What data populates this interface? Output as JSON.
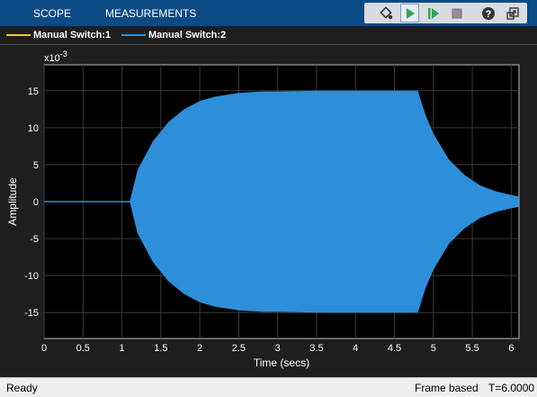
{
  "toolstrip": {
    "tabs": [
      "SCOPE",
      "MEASUREMENTS"
    ],
    "buttons": [
      "highlight-simulink-block-icon",
      "run-icon",
      "step-forward-icon",
      "stop-icon",
      "help-icon",
      "undock-icon"
    ]
  },
  "legend": {
    "items": [
      {
        "label": "Manual Switch:1",
        "color": "#f2c230"
      },
      {
        "label": "Manual Switch:2",
        "color": "#2d8fd9"
      }
    ]
  },
  "status": {
    "left": "Ready",
    "mode": "Frame based",
    "time": "T=6.0000"
  },
  "chart_data": {
    "type": "line",
    "xlabel": "Time (secs)",
    "ylabel": "Amplitude",
    "y_exponent_label": "x10",
    "y_exponent_power": "-3",
    "xlim": [
      0,
      6.1
    ],
    "ylim": [
      -0.0185,
      0.0185
    ],
    "x_ticks": [
      0,
      0.5,
      1,
      1.5,
      2,
      2.5,
      3,
      3.5,
      4,
      4.5,
      5,
      5.5,
      6
    ],
    "x_tick_labels": [
      "0",
      "0.5",
      "1",
      "1.5",
      "2",
      "2.5",
      "3",
      "3.5",
      "4",
      "4.5",
      "5",
      "5.5",
      "6"
    ],
    "y_ticks": [
      -0.015,
      -0.01,
      -0.005,
      0,
      0.005,
      0.01,
      0.015
    ],
    "y_tick_labels": [
      "-15",
      "-10",
      "-5",
      "0",
      "5",
      "10",
      "15"
    ],
    "grid": true,
    "background": "#000000",
    "series": [
      {
        "name": "Manual Switch:1",
        "color": "#f2c230",
        "envelope_time": [
          0,
          1.1
        ],
        "envelope_amplitude": [
          0,
          0
        ]
      },
      {
        "name": "Manual Switch:2",
        "color": "#2d8fd9",
        "envelope_time": [
          0,
          1.1,
          1.2,
          1.4,
          1.6,
          1.8,
          2.0,
          2.2,
          2.5,
          2.8,
          3.0,
          3.5,
          4.0,
          4.5,
          4.8,
          4.9,
          5.0,
          5.2,
          5.4,
          5.6,
          5.8,
          6.0,
          6.1
        ],
        "envelope_amplitude": [
          0,
          0,
          0.0043,
          0.0082,
          0.0108,
          0.0125,
          0.0136,
          0.0142,
          0.0147,
          0.0149,
          0.0149,
          0.015,
          0.015,
          0.015,
          0.015,
          0.0117,
          0.0092,
          0.0057,
          0.0036,
          0.0022,
          0.0014,
          0.0009,
          0.0007
        ]
      }
    ]
  }
}
